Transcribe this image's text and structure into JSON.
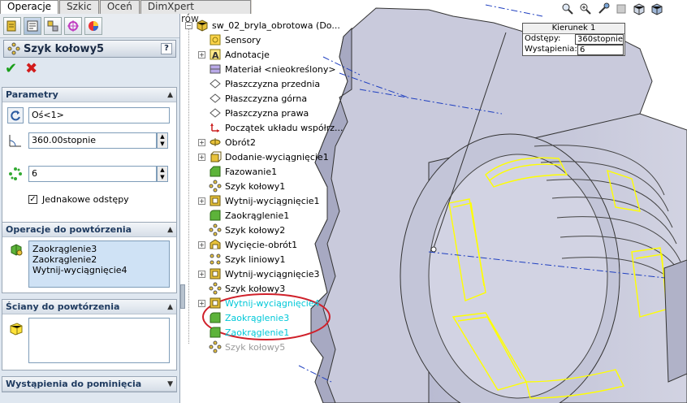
{
  "tabs": [
    "Operacje",
    "Szkic",
    "Oceń",
    "DimXpert Wymiarów"
  ],
  "pm_icons": [
    "feature-manager-icon",
    "property-manager-icon",
    "configuration-manager-icon",
    "dimxpert-icon",
    "display-manager-icon"
  ],
  "property_manager": {
    "title": "Szyk kołowy5",
    "help": "?",
    "ok": "✔",
    "cancel": "✖",
    "parameters": {
      "header": "Parametry",
      "axis_value": "Oś<1>",
      "angle_value": "360.00stopnie",
      "instances_value": "6",
      "equal_spacing_label": "Jednakowe odstępy",
      "equal_spacing_checked": true
    },
    "features_to_pattern": {
      "header": "Operacje do powtórzenia",
      "items": [
        "Zaokrąglenie3",
        "Zaokrąglenie2",
        "Wytnij-wyciągnięcie4"
      ]
    },
    "faces_to_pattern": {
      "header": "Ściany do powtórzenia"
    },
    "instances_to_skip": {
      "header": "Wystąpienia do pominięcia"
    }
  },
  "tree": {
    "root": "sw_02_bryla_obrotowa  (Do...",
    "items": [
      {
        "label": "Sensory",
        "icon": "sensor-icon",
        "expand": false,
        "color": "#000000"
      },
      {
        "label": "Adnotacje",
        "icon": "annotation-icon",
        "expand": true,
        "color": "#000000"
      },
      {
        "label": "Materiał <nieokreślony>",
        "icon": "material-icon",
        "expand": false,
        "color": "#000000"
      },
      {
        "label": "Płaszczyzna przednia",
        "icon": "plane-icon",
        "expand": false,
        "color": "#000000"
      },
      {
        "label": "Płaszczyzna górna",
        "icon": "plane-icon",
        "expand": false,
        "color": "#000000"
      },
      {
        "label": "Płaszczyzna prawa",
        "icon": "plane-icon",
        "expand": false,
        "color": "#000000"
      },
      {
        "label": "Początek układu współrz...",
        "icon": "origin-icon",
        "expand": false,
        "color": "#000000"
      },
      {
        "label": "Obrót2",
        "icon": "revolve-icon",
        "expand": true,
        "color": "#000000"
      },
      {
        "label": "Dodanie-wyciągnięcie1",
        "icon": "extrude-icon",
        "expand": true,
        "color": "#000000"
      },
      {
        "label": "Fazowanie1",
        "icon": "chamfer-icon",
        "expand": false,
        "color": "#000000"
      },
      {
        "label": "Szyk kołowy1",
        "icon": "circular-pattern-icon",
        "expand": false,
        "color": "#000000"
      },
      {
        "label": "Wytnij-wyciągnięcie1",
        "icon": "cut-extrude-icon",
        "expand": true,
        "color": "#000000"
      },
      {
        "label": "Zaokrąglenie1",
        "icon": "fillet-icon",
        "expand": false,
        "color": "#000000"
      },
      {
        "label": "Szyk kołowy2",
        "icon": "circular-pattern-icon",
        "expand": false,
        "color": "#000000"
      },
      {
        "label": "Wycięcie-obrót1",
        "icon": "revolve-cut-icon",
        "expand": true,
        "color": "#000000"
      },
      {
        "label": "Szyk liniowy1",
        "icon": "linear-pattern-icon",
        "expand": false,
        "color": "#000000"
      },
      {
        "label": "Wytnij-wyciągnięcie3",
        "icon": "cut-extrude-icon",
        "expand": true,
        "color": "#000000"
      },
      {
        "label": "Szyk kołowy3",
        "icon": "circular-pattern-icon",
        "expand": false,
        "color": "#000000"
      },
      {
        "label": "Wytnij-wyciągnięcie4",
        "icon": "cut-extrude-icon",
        "expand": true,
        "color": "#00c8d8"
      },
      {
        "label": "Zaokrąglenie3",
        "icon": "fillet-icon",
        "expand": false,
        "color": "#00c8d8"
      },
      {
        "label": "Zaokrąglenie1",
        "icon": "fillet-icon",
        "expand": false,
        "color": "#00c8d8"
      },
      {
        "label": "Szyk kołowy5",
        "icon": "circular-pattern-icon",
        "expand": false,
        "color": "#9a9a9a"
      }
    ]
  },
  "callout": {
    "title": "Kierunek 1",
    "spacing_label": "Odstępy:",
    "spacing_value": "360stopnie",
    "instances_label": "Wystąpienia:",
    "instances_value": "6"
  },
  "view_toolbar": [
    "zoom-to-fit-icon",
    "zoom-area-icon",
    "previous-view-icon",
    "section-view-icon",
    "view-orientation-icon",
    "display-style-icon"
  ],
  "colors": {
    "selection": "#00c8d8",
    "highlight_ellipse": "#d0202a",
    "preview": "#ffff00",
    "model": "#c8cadc"
  }
}
